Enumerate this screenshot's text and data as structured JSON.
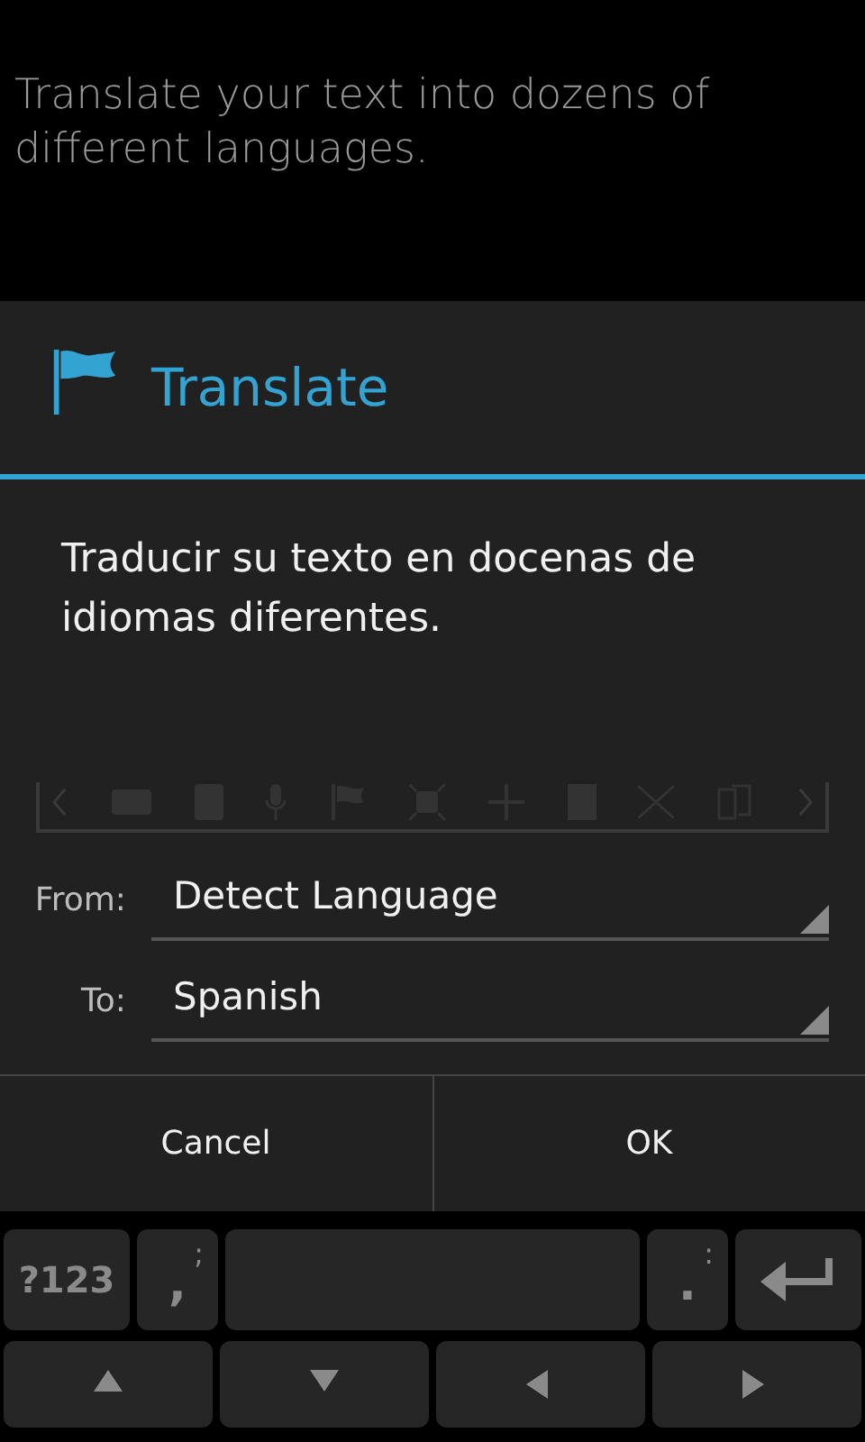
{
  "background_text": "Translate your text into dozens of different languages.",
  "dialog": {
    "title": "Translate",
    "message": "Traducir su texto en docenas de idiomas diferentes.",
    "fields": [
      {
        "label": "From:",
        "value": "Detect Language"
      },
      {
        "label": "To:",
        "value": "Spanish"
      }
    ],
    "buttons": [
      "Cancel",
      "OK"
    ]
  },
  "keyboard": {
    "rows": [
      [
        {
          "kind": "text",
          "label": "?123"
        },
        {
          "kind": "punct",
          "label": ",",
          "alt": ";"
        },
        {
          "kind": "space"
        },
        {
          "kind": "punct",
          "label": ".",
          "alt": ":"
        },
        {
          "kind": "enter"
        }
      ],
      [
        {
          "kind": "up"
        },
        {
          "kind": "down"
        },
        {
          "kind": "left"
        },
        {
          "kind": "right"
        }
      ]
    ]
  }
}
